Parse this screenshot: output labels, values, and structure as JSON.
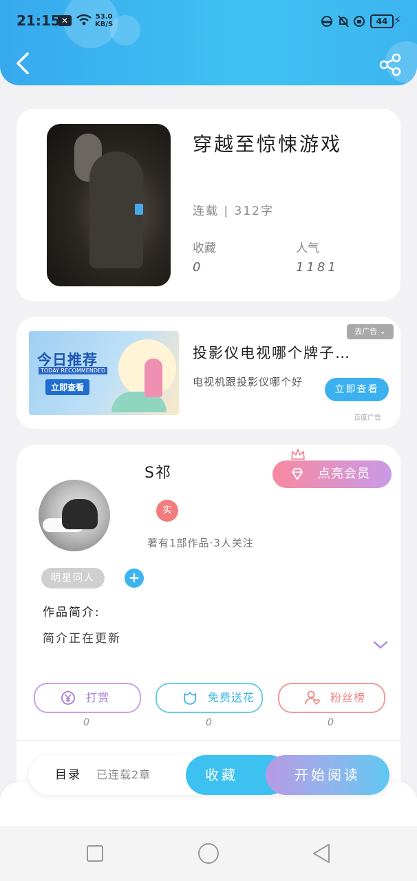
{
  "status_bar": {
    "time": "21:15",
    "net_speed": "53.0",
    "net_unit": "KB/S",
    "battery": "44"
  },
  "book": {
    "title": "穿越至惊悚游戏",
    "status": "连载 | 312字",
    "favorites_label": "收藏",
    "favorites_value": "0",
    "popularity_label": "人气",
    "popularity_value": "1181"
  },
  "ad": {
    "tag": "去广告 ⌄",
    "image_headline": "今日推荐",
    "image_sub": "TODAY RECOMMENDED",
    "image_cta": "立即查看",
    "title": "投影仪电视哪个牌子…",
    "description": "电视机跟投影仪哪个好",
    "button": "立即查看",
    "source": "百度广告"
  },
  "author": {
    "name": "S祁",
    "vip_button": "点亮会员",
    "real_badge": "实",
    "works_info": "著有1部作品·3人关注",
    "tag": "明星同人",
    "add_tag": "+",
    "intro_label": "作品简介:",
    "intro_text": "简介正在更新"
  },
  "actions": {
    "reward": {
      "label": "打赏",
      "count": "0"
    },
    "flower": {
      "label": "免费送花",
      "count": "0"
    },
    "fans": {
      "label": "粉丝榜",
      "count": "0"
    }
  },
  "bottom_bar": {
    "toc_label": "目录",
    "chapters": "已连载2章",
    "collect": "收藏",
    "read": "开始阅读"
  },
  "colors": {
    "header": "#37a9ee",
    "accent": "#3cc1f0",
    "vip": "#f78aa0"
  },
  "icons": [
    "back-icon",
    "share-icon",
    "diamond-icon",
    "crown-icon",
    "yen-icon",
    "flower-icon",
    "user-heart-icon",
    "chevron-down-icon",
    "nav-recents-icon",
    "nav-home-icon",
    "nav-back-icon"
  ]
}
